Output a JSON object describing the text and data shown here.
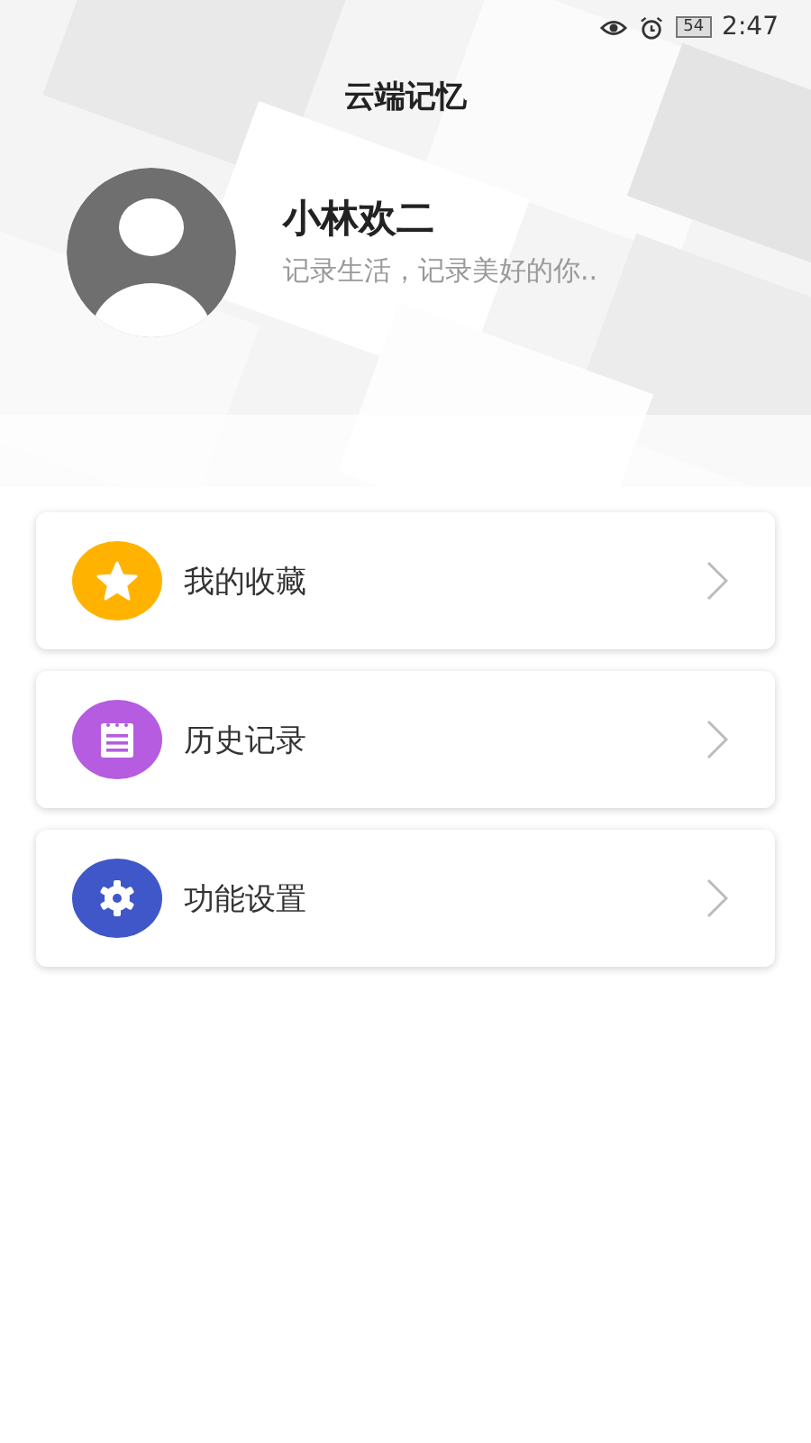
{
  "status_bar": {
    "battery": "54",
    "time": "2:47"
  },
  "header": {
    "title": "云端记忆",
    "kind": "picture"
  },
  "profile": {
    "name": "小林欢二",
    "motto": "记录生活，记录美好的你.."
  },
  "menu": [
    {
      "label": "我的收藏",
      "kind": "star",
      "color": "#ffb300"
    },
    {
      "label": "历史记录",
      "kind": "notepad",
      "color": "#b55ce0"
    },
    {
      "label": "功能设置",
      "kind": "gear",
      "color": "#3f57c8"
    }
  ]
}
